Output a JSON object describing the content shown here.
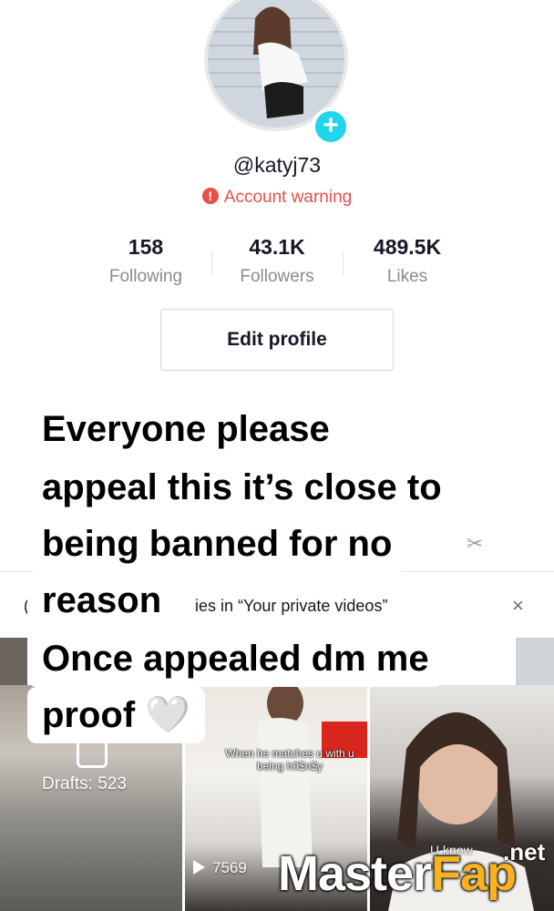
{
  "profile": {
    "username": "@katyj73",
    "warning": "Account warning",
    "warning_icon": "exclamation-icon",
    "plus": "+",
    "accent": "#20d5ec",
    "warning_color": "#e8504a"
  },
  "stats": [
    {
      "value": "158",
      "label": "Following"
    },
    {
      "value": "43.1K",
      "label": "Followers"
    },
    {
      "value": "489.5K",
      "label": "Likes"
    }
  ],
  "edit_profile_label": "Edit profile",
  "overlay_lines": [
    "Everyone please",
    "appeal this it’s close to",
    "being banned for no",
    "reason",
    "Once appealed dm me",
    "proof"
  ],
  "overlay_emoji": "🤍",
  "private_bar": {
    "text": "ies in “Your private videos”",
    "edge": "(",
    "close": "×"
  },
  "videos": {
    "drafts_label": "Drafts: 523",
    "tile2_caption": "When he matches u with u being h0$n$y",
    "tile2_views": "7569",
    "tile3_caption": "U know"
  },
  "watermark": {
    "master": "Master",
    "fap": "Fap",
    "net": ".net"
  }
}
